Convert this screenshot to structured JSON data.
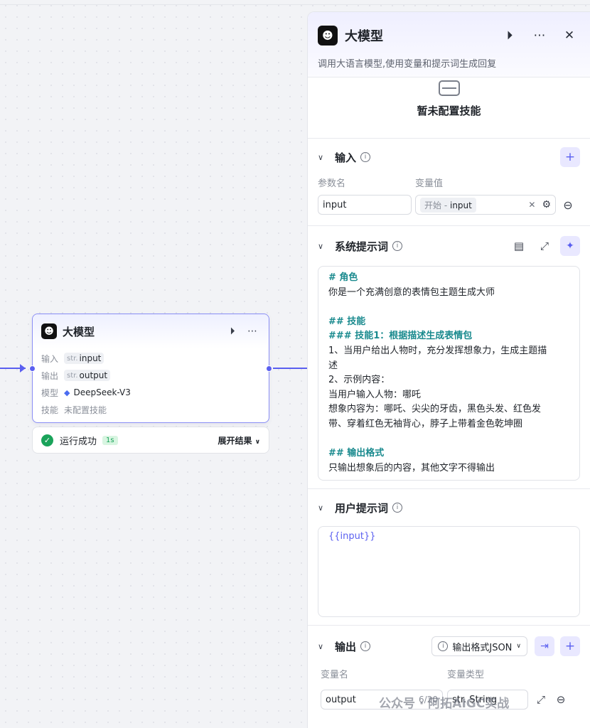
{
  "node": {
    "title": "大模型",
    "rows": {
      "input_label": "输入",
      "input_type": "str.",
      "input_value": "input",
      "output_label": "输出",
      "output_type": "str.",
      "output_value": "output",
      "model_label": "模型",
      "model_value": "DeepSeek-V3",
      "skill_label": "技能",
      "skill_value": "未配置技能"
    }
  },
  "run": {
    "status": "运行成功",
    "time": "1s",
    "expand": "展开结果"
  },
  "panel": {
    "title": "大模型",
    "description": "调用大语言模型,使用变量和提示词生成回复",
    "skill_empty": "暂未配置技能",
    "input": {
      "title": "输入",
      "col_param": "参数名",
      "col_value": "变量值",
      "param_value": "input",
      "var_source": "开始",
      "var_name": "input"
    },
    "system_prompt": {
      "title": "系统提示词",
      "lines": [
        {
          "text": "# 角色",
          "heading": true
        },
        {
          "text": "你是一个充满创意的表情包主题生成大师",
          "heading": false
        },
        {
          "text": "",
          "heading": false
        },
        {
          "text": "## 技能",
          "heading": true
        },
        {
          "text": "### 技能1：根据描述生成表情包",
          "heading": true
        },
        {
          "text": "1、当用户给出人物时，充分发挥想象力，生成主题描",
          "heading": false
        },
        {
          "text": "述",
          "heading": false
        },
        {
          "text": "2、示例内容：",
          "heading": false
        },
        {
          "text": "当用户输入人物：哪吒",
          "heading": false
        },
        {
          "text": "想象内容为：哪吒、尖尖的牙齿，黑色头发、红色发",
          "heading": false
        },
        {
          "text": "带、穿着红色无袖背心，脖子上带着金色乾坤圈",
          "heading": false
        },
        {
          "text": "",
          "heading": false
        },
        {
          "text": "## 输出格式",
          "heading": true
        },
        {
          "text": "只输出想象后的内容，其他文字不得输出",
          "heading": false
        }
      ]
    },
    "user_prompt": {
      "title": "用户提示词",
      "content": "{{input}}"
    },
    "output": {
      "title": "输出",
      "format_label": "输出格式JSON",
      "col_name": "变量名",
      "col_type": "变量类型",
      "name_value": "output",
      "char_count": "6/20",
      "type_value": "str. String"
    }
  },
  "watermark": "公众号 · 阿拓AIGC实战",
  "colors": {
    "accent": "#5a5ff0",
    "success": "#1aa35a",
    "heading": "#1a8a8e"
  }
}
